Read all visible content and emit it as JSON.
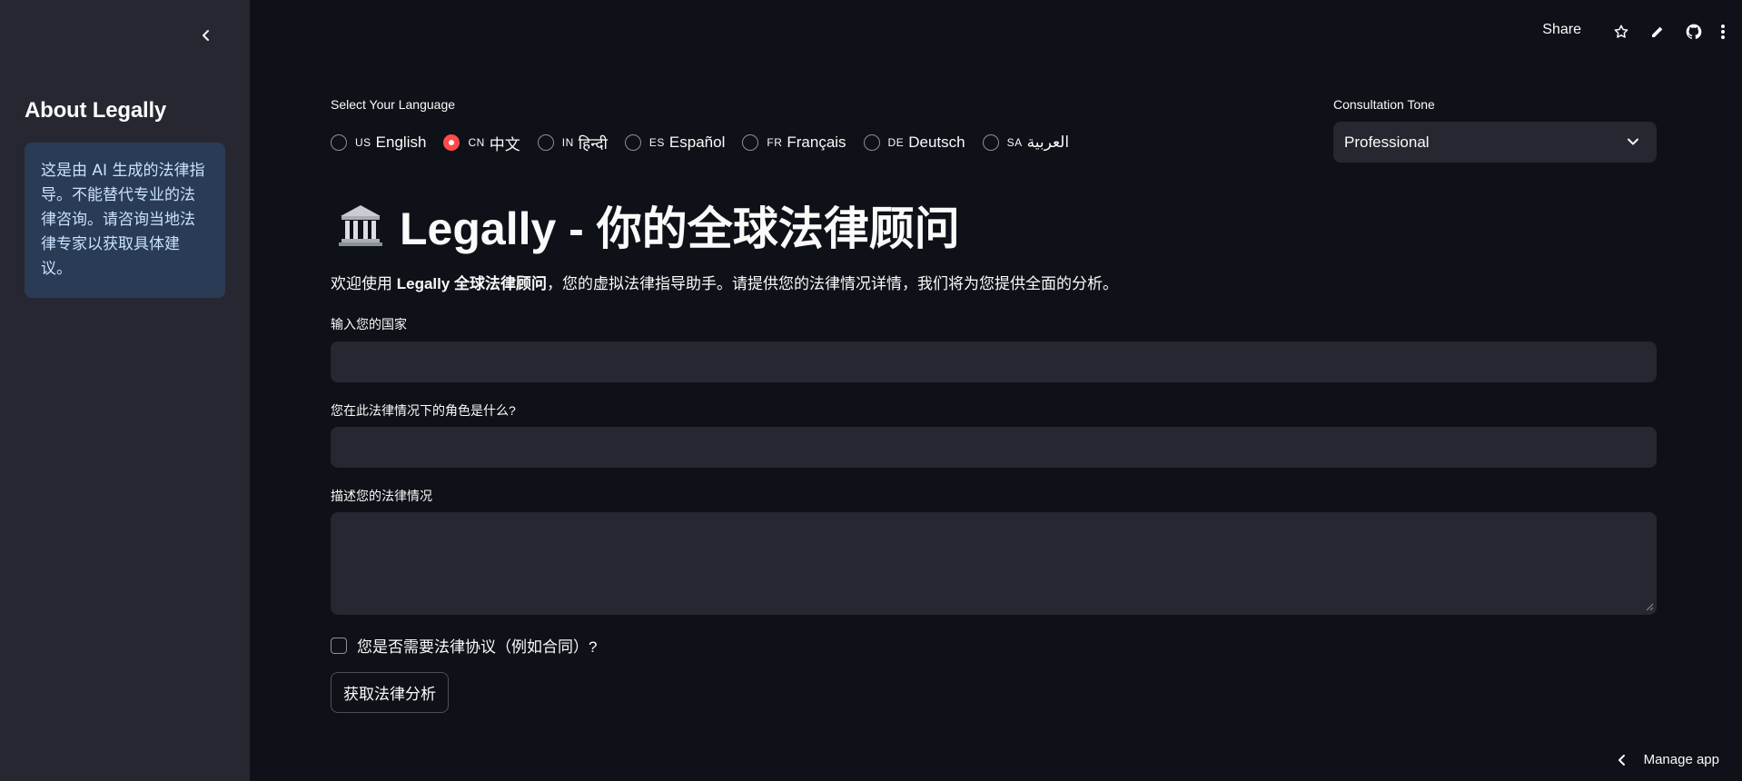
{
  "sidebar": {
    "collapse_icon": "chevron-left-icon",
    "title": "About Legally",
    "info_text": "这是由 AI 生成的法律指导。不能替代专业的法律咨询。请咨询当地法律专家以获取具体建议。"
  },
  "topbar": {
    "share_label": "Share",
    "icons": [
      "star-icon",
      "edit-pencil-icon",
      "github-icon",
      "more-vertical-icon"
    ]
  },
  "language": {
    "label": "Select Your Language",
    "selected": "中文",
    "options": [
      {
        "code": "US",
        "name": "English",
        "selected": false
      },
      {
        "code": "CN",
        "name": "中文",
        "selected": true
      },
      {
        "code": "IN",
        "name": "हिन्दी",
        "selected": false
      },
      {
        "code": "ES",
        "name": "Español",
        "selected": false
      },
      {
        "code": "FR",
        "name": "Français",
        "selected": false
      },
      {
        "code": "DE",
        "name": "Deutsch",
        "selected": false
      },
      {
        "code": "SA",
        "name": "العربية",
        "selected": false
      }
    ]
  },
  "tone": {
    "label": "Consultation Tone",
    "value": "Professional"
  },
  "header": {
    "icon": "classical-building-icon",
    "title": "Legally - 你的全球法律顾问"
  },
  "welcome": {
    "prefix": "欢迎使用 ",
    "bold": "Legally 全球法律顾问",
    "suffix": "，您的虚拟法律指导助手。请提供您的法律情况详情，我们将为您提供全面的分析。"
  },
  "form": {
    "country_label": "输入您的国家",
    "country_value": "",
    "role_label": "您在此法律情况下的角色是什么?",
    "role_value": "",
    "situation_label": "描述您的法律情况",
    "situation_value": "",
    "agreement_checkbox_label": "您是否需要法律协议（例如合同）?",
    "agreement_checked": false,
    "submit_label": "获取法律分析"
  },
  "footer": {
    "manage_app_label": "Manage app"
  },
  "colors": {
    "background": "#0e1117",
    "sidebar": "#262730",
    "input": "#262730",
    "accent": "#ff4b4b",
    "info_bg": "#2a3b55",
    "info_text": "#c7e1ff"
  }
}
